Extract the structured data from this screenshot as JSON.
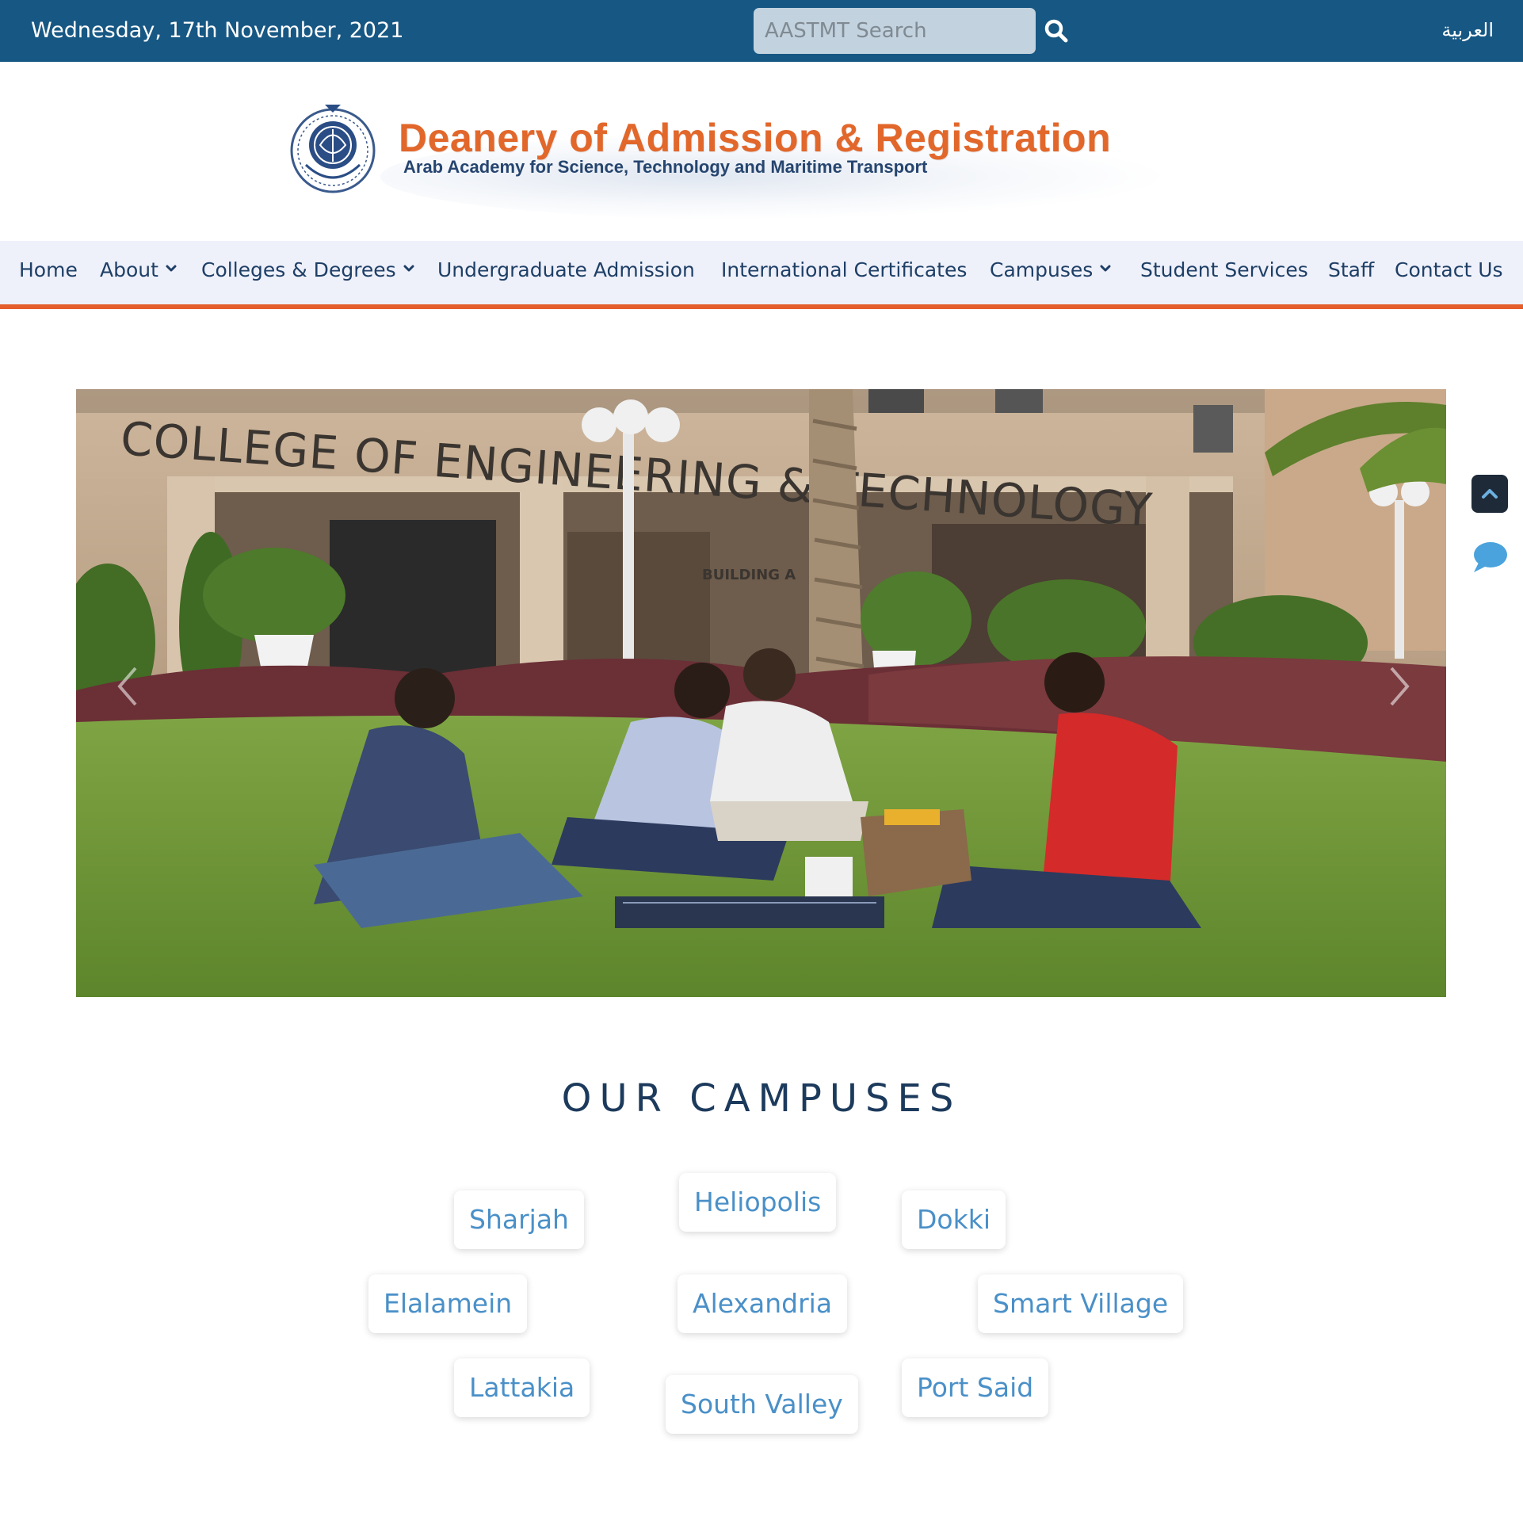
{
  "topbar": {
    "date": "Wednesday, 17th November, 2021",
    "search_placeholder": "AASTMT Search",
    "search_value": "",
    "lang_label": "العربية"
  },
  "header": {
    "title": "Deanery of Admission & Registration",
    "subtitle": "Arab Academy for Science, Technology and Maritime Transport"
  },
  "nav": {
    "items": [
      {
        "label": "Home",
        "dropdown": false
      },
      {
        "label": "About",
        "dropdown": true
      },
      {
        "label": "Colleges & Degrees",
        "dropdown": true
      },
      {
        "label": "Undergraduate Admission",
        "dropdown": false
      },
      {
        "label": "International Certificates",
        "dropdown": false
      },
      {
        "label": "Campuses",
        "dropdown": true
      },
      {
        "label": "Student Services",
        "dropdown": false
      },
      {
        "label": "Staff",
        "dropdown": false
      },
      {
        "label": "Contact Us",
        "dropdown": false
      }
    ]
  },
  "hero": {
    "building_sign": "COLLEGE OF ENGINEERING & TECHNOLOGY",
    "building_label": "BUILDING A"
  },
  "campuses": {
    "heading": "OUR CAMPUSES",
    "items": [
      "Sharjah",
      "Heliopolis",
      "Dokki",
      "Elalamein",
      "Alexandria",
      "Smart Village",
      "Lattakia",
      "South Valley",
      "Port Said"
    ]
  },
  "colors": {
    "topbar": "#175783",
    "accent_orange": "#e45f2b",
    "nav_bg": "#eef0fa",
    "nav_text": "#1e3f66",
    "campus_text": "#4a90c8",
    "heading_text": "#1c3a5c"
  },
  "icons": {
    "search": "search-icon",
    "scroll_top": "chevron-up-icon",
    "chat": "chat-bubble-icon",
    "prev": "chevron-left-icon",
    "next": "chevron-right-icon",
    "dropdown": "chevron-down-icon",
    "logo": "academy-seal-logo"
  }
}
